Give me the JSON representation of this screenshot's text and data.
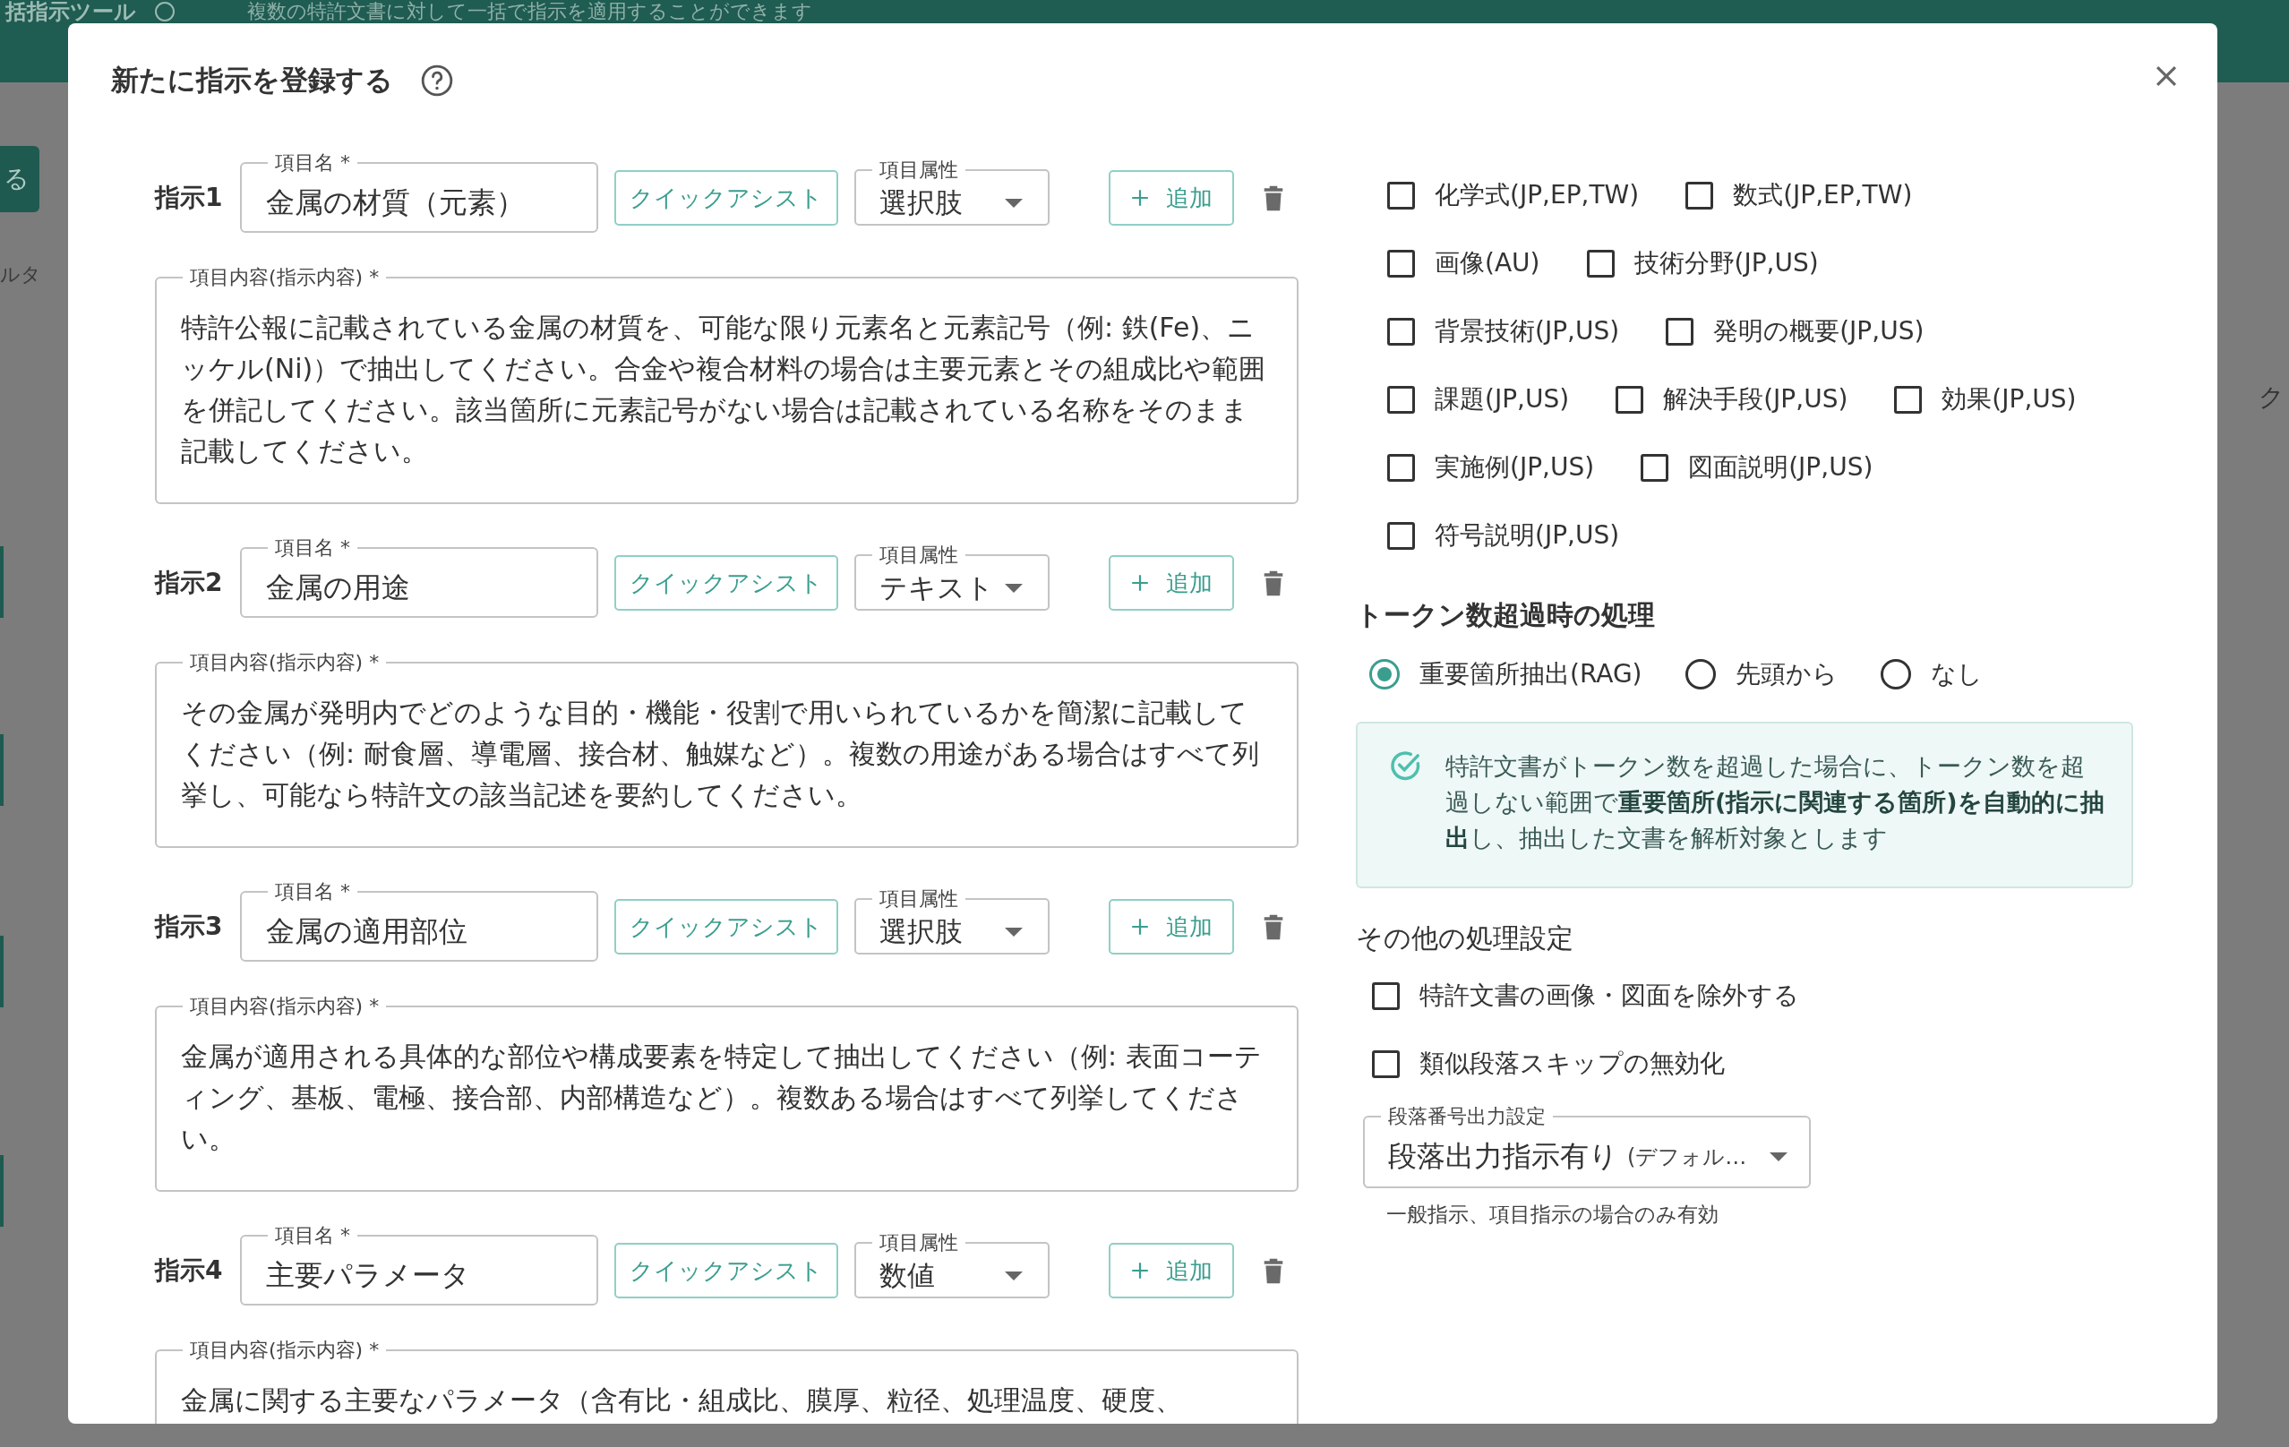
{
  "background": {
    "app_title": "括指示ツール",
    "subtitle": "複数の特許文書に対して一括で指示を適用することができます",
    "side_button": "る",
    "filter_label": "ルタ",
    "right_fragment": "ク"
  },
  "dialog": {
    "title": "新たに指示を登録する",
    "instructions": [
      {
        "label": "指示1",
        "name_label": "項目名 *",
        "name": "金属の材質（元素）",
        "assist": "クイックアシスト",
        "attr_label": "項目属性",
        "attr": "選択肢",
        "add": "追加",
        "content_label": "項目内容(指示内容) *",
        "content": "特許公報に記載されている金属の材質を、可能な限り元素名と元素記号（例: 鉄(Fe)、ニッケル(Ni)）で抽出してください。合金や複合材料の場合は主要元素とその組成比や範囲を併記してください。該当箇所に元素記号がない場合は記載されている名称をそのまま記載してください。"
      },
      {
        "label": "指示2",
        "name_label": "項目名 *",
        "name": "金属の用途",
        "assist": "クイックアシスト",
        "attr_label": "項目属性",
        "attr": "テキスト",
        "add": "追加",
        "content_label": "項目内容(指示内容) *",
        "content": "その金属が発明内でどのような目的・機能・役割で用いられているかを簡潔に記載してください（例: 耐食層、導電層、接合材、触媒など）。複数の用途がある場合はすべて列挙し、可能なら特許文の該当記述を要約してください。"
      },
      {
        "label": "指示3",
        "name_label": "項目名 *",
        "name": "金属の適用部位",
        "assist": "クイックアシスト",
        "attr_label": "項目属性",
        "attr": "選択肢",
        "add": "追加",
        "content_label": "項目内容(指示内容) *",
        "content": "金属が適用される具体的な部位や構成要素を特定して抽出してください（例: 表面コーティング、基板、電極、接合部、内部構造など）。複数ある場合はすべて列挙してください。"
      },
      {
        "label": "指示4",
        "name_label": "項目名 *",
        "name": "主要パラメータ",
        "assist": "クイックアシスト",
        "attr_label": "項目属性",
        "attr": "数値",
        "add": "追加",
        "content_label": "項目内容(指示内容) *",
        "content": "金属に関する主要なパラメータ（含有比・組成比、膜厚、粒径、処理温度、硬度、"
      }
    ],
    "sections": [
      [
        {
          "label": "化学式(JP,EP,TW)",
          "checked": false
        },
        {
          "label": "数式(JP,EP,TW)",
          "checked": false
        }
      ],
      [
        {
          "label": "画像(AU)",
          "checked": false
        },
        {
          "label": "技術分野(JP,US)",
          "checked": false
        }
      ],
      [
        {
          "label": "背景技術(JP,US)",
          "checked": false
        },
        {
          "label": "発明の概要(JP,US)",
          "checked": false
        }
      ],
      [
        {
          "label": "課題(JP,US)",
          "checked": false
        },
        {
          "label": "解決手段(JP,US)",
          "checked": false
        },
        {
          "label": "効果(JP,US)",
          "checked": false
        }
      ],
      [
        {
          "label": "実施例(JP,US)",
          "checked": false
        },
        {
          "label": "図面説明(JP,US)",
          "checked": false
        }
      ],
      [
        {
          "label": "符号説明(JP,US)",
          "checked": false
        }
      ]
    ],
    "token": {
      "title": "トークン数超過時の処理",
      "options": [
        {
          "label": "重要箇所抽出(RAG)",
          "selected": true
        },
        {
          "label": "先頭から",
          "selected": false
        },
        {
          "label": "なし",
          "selected": false
        }
      ],
      "info": "特許文書がトークン数を超過した場合に、トークン数を超過しない範囲で**重要箇所(指示に関連する箇所)を自動的に抽出**し、抽出した文書を解析対象とします"
    },
    "other": {
      "title": "その他の処理設定",
      "options": [
        {
          "label": "特許文書の画像・図面を除外する",
          "checked": false
        },
        {
          "label": "類似段落スキップの無効化",
          "checked": false
        }
      ],
      "select": {
        "label": "段落番号出力設定",
        "value": "段落出力指示有り",
        "note": "(デフォル…"
      },
      "helper": "一般指示、項目指示の場合のみ有効"
    }
  }
}
